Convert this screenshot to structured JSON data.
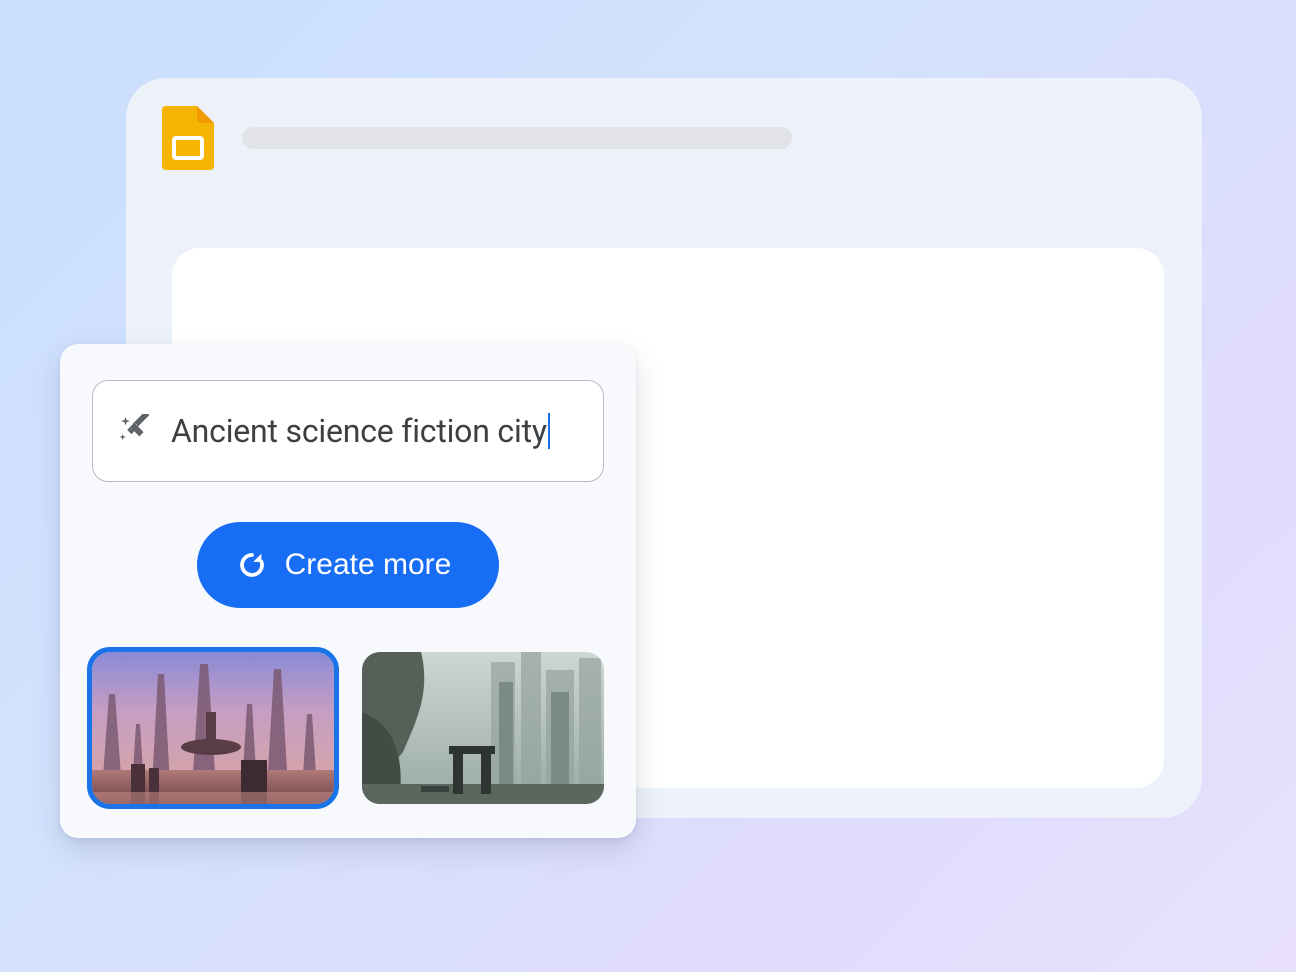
{
  "app": {
    "product_icon": "google-slides"
  },
  "ai_panel": {
    "prompt_icon": "magic-wand",
    "prompt_text": "Ancient science fiction city",
    "create_button_label": "Create more",
    "create_button_icon": "refresh",
    "results": [
      {
        "selected": true,
        "alt": "Ancient sci-fi city, warm pink/purple skies with tall spires"
      },
      {
        "selected": false,
        "alt": "Ancient sci-fi city, hazy grey-green ruins with towers"
      }
    ]
  }
}
